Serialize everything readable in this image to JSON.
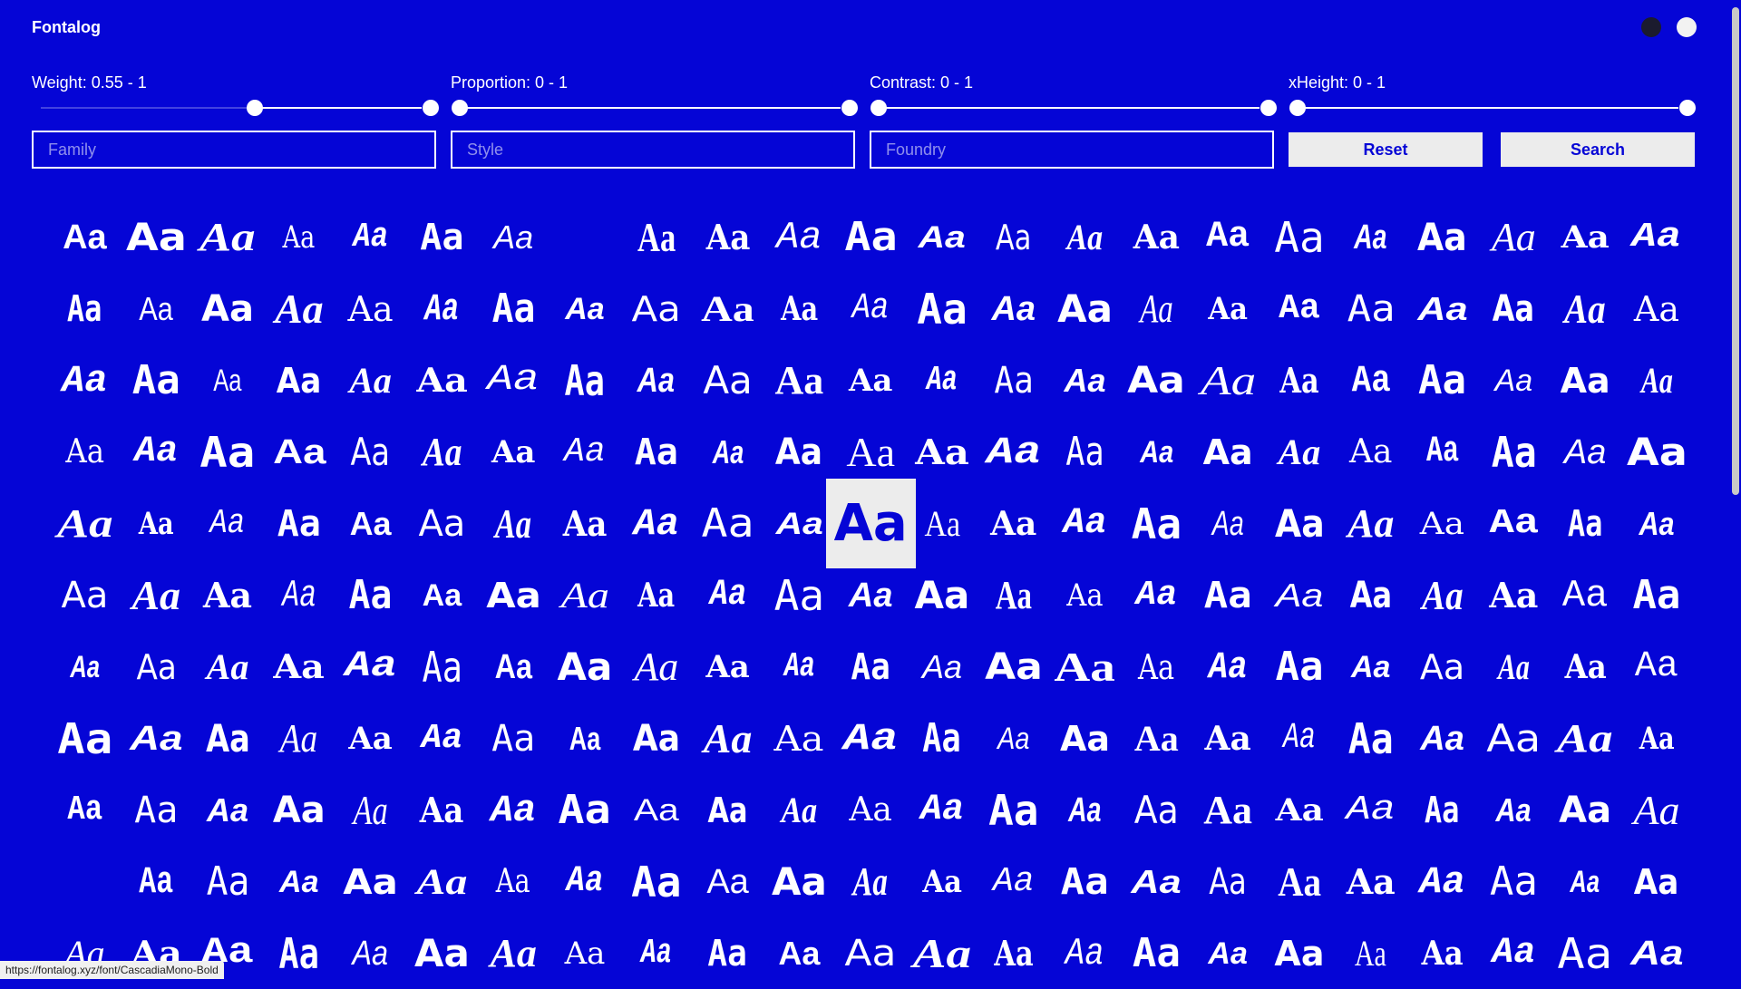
{
  "app": {
    "title": "Fontalog"
  },
  "theme_toggle": {
    "dark_color": "#1b1b2e",
    "light_color": "#f2f2f2"
  },
  "colors": {
    "background": "#0505d6",
    "foreground": "#ffffff",
    "button_bg": "#ececec",
    "button_text": "#0505d6"
  },
  "sliders": [
    {
      "label": "Weight: 0.55 - 1",
      "min": 0.55,
      "max": 1
    },
    {
      "label": "Proportion: 0 - 1",
      "min": 0,
      "max": 1
    },
    {
      "label": "Contrast: 0 - 1",
      "min": 0,
      "max": 1
    },
    {
      "label": "xHeight: 0 - 1",
      "min": 0,
      "max": 1
    }
  ],
  "filters": {
    "family_placeholder": "Family",
    "style_placeholder": "Style",
    "foundry_placeholder": "Foundry",
    "reset_label": "Reset",
    "search_label": "Search"
  },
  "grid": {
    "sample_text": "Aa",
    "columns": 23,
    "cell_count": 253,
    "empty_cells": [
      7,
      207
    ],
    "highlighted_cell": 103
  },
  "status_bar": {
    "url": "https://fontalog.xyz/font/CascadiaMono-Bold"
  },
  "icons": {
    "theme_dark": "dark-theme-circle-icon",
    "theme_light": "light-theme-circle-icon"
  }
}
